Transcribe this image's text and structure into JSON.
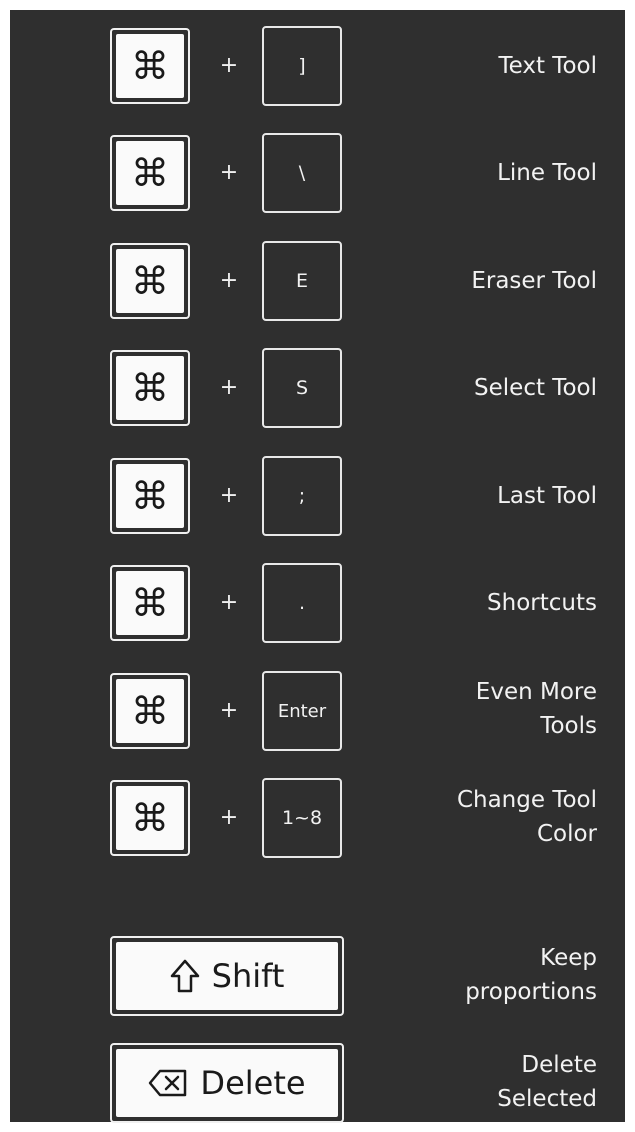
{
  "colors": {
    "panel_background": "#2f2f2f",
    "key_outline": "#f0f0f0",
    "key_face": "#fafafa",
    "text": "#f2f2f2"
  },
  "icons": {
    "modifier": "command-icon",
    "shift": "shift-arrow-icon",
    "delete": "delete-backspace-icon"
  },
  "modifier_symbol": "⌘",
  "plus_sign": "+",
  "shortcuts": [
    {
      "key": "]",
      "label": [
        "Text Tool"
      ]
    },
    {
      "key": "\\",
      "label": [
        "Line Tool"
      ]
    },
    {
      "key": "E",
      "label": [
        "Eraser Tool"
      ]
    },
    {
      "key": "S",
      "label": [
        "Select Tool"
      ]
    },
    {
      "key": ";",
      "label": [
        "Last Tool"
      ]
    },
    {
      "key": ".",
      "label": [
        "Shortcuts"
      ]
    },
    {
      "key": "Enter",
      "label": [
        "Even More",
        "Tools"
      ]
    },
    {
      "key": "1~8",
      "label": [
        "Change Tool",
        "Color"
      ]
    }
  ],
  "single_keys": [
    {
      "key": "Shift",
      "label": [
        "Keep",
        "proportions"
      ]
    },
    {
      "key": "Delete",
      "label": [
        "Delete",
        "Selected"
      ]
    }
  ]
}
